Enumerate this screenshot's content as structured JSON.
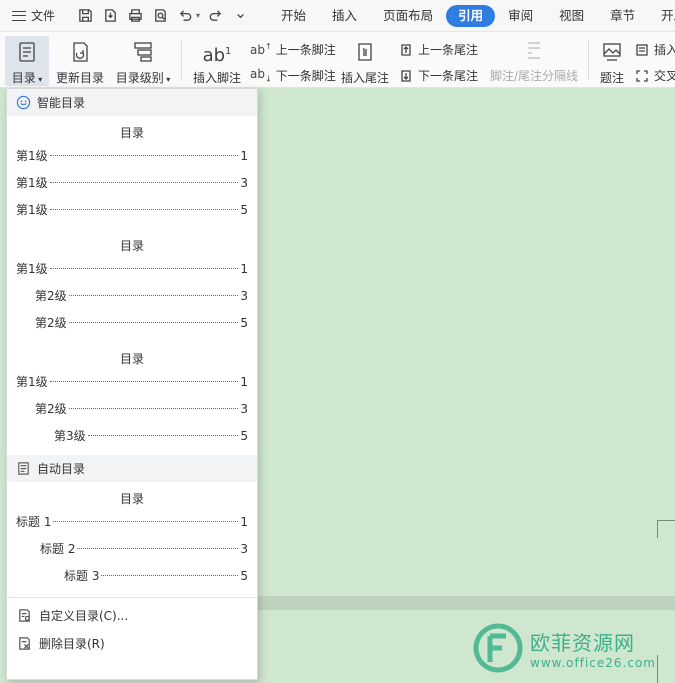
{
  "topbar": {
    "file_label": "文件",
    "tabs": [
      {
        "label": "开始",
        "active": false
      },
      {
        "label": "插入",
        "active": false
      },
      {
        "label": "页面布局",
        "active": false
      },
      {
        "label": "引用",
        "active": true
      },
      {
        "label": "审阅",
        "active": false
      },
      {
        "label": "视图",
        "active": false
      },
      {
        "label": "章节",
        "active": false
      },
      {
        "label": "开发",
        "active": false
      }
    ]
  },
  "ribbon": {
    "toc": "目录",
    "update_toc": "更新目录",
    "toc_level": "目录级别",
    "insert_footnote": "插入脚注",
    "prev_footnote": "上一条脚注",
    "next_footnote": "下一条脚注",
    "insert_endnote": "插入尾注",
    "prev_endnote": "上一条尾注",
    "next_endnote": "下一条尾注",
    "separator_line": "脚注/尾注分隔线",
    "caption": "题注",
    "insert_short": "插入",
    "cross_ref_short": "交叉"
  },
  "dropdown": {
    "smart_toc_header": "智能目录",
    "auto_toc_header": "自动目录",
    "smart_tocs": [
      {
        "title": "目录",
        "entries": [
          {
            "text": "第1级",
            "page": "1",
            "level": 1
          },
          {
            "text": "第1级",
            "page": "3",
            "level": 1
          },
          {
            "text": "第1级",
            "page": "5",
            "level": 1
          }
        ]
      },
      {
        "title": "目录",
        "entries": [
          {
            "text": "第1级",
            "page": "1",
            "level": 1
          },
          {
            "text": "第2级",
            "page": "3",
            "level": 2
          },
          {
            "text": "第2级",
            "page": "5",
            "level": 2
          }
        ]
      },
      {
        "title": "目录",
        "entries": [
          {
            "text": "第1级",
            "page": "1",
            "level": 1
          },
          {
            "text": "第2级",
            "page": "3",
            "level": 2
          },
          {
            "text": "第3级",
            "page": "5",
            "level": 3
          }
        ]
      }
    ],
    "auto_toc": {
      "title": "目录",
      "entries": [
        {
          "text": "标题 1",
          "page": "1",
          "level": 1
        },
        {
          "text": "标题 2",
          "page": "3",
          "level": 2
        },
        {
          "text": "标题 3",
          "page": "5",
          "level": 3
        }
      ]
    },
    "custom_toc": "自定义目录(C)...",
    "delete_toc": "删除目录(R)"
  },
  "watermark": {
    "name": "欧菲资源网",
    "url": "www.office26.com"
  },
  "colors": {
    "accent": "#2f7de1",
    "document_bg": "#cfe6cf",
    "watermark": "#3db08a"
  }
}
